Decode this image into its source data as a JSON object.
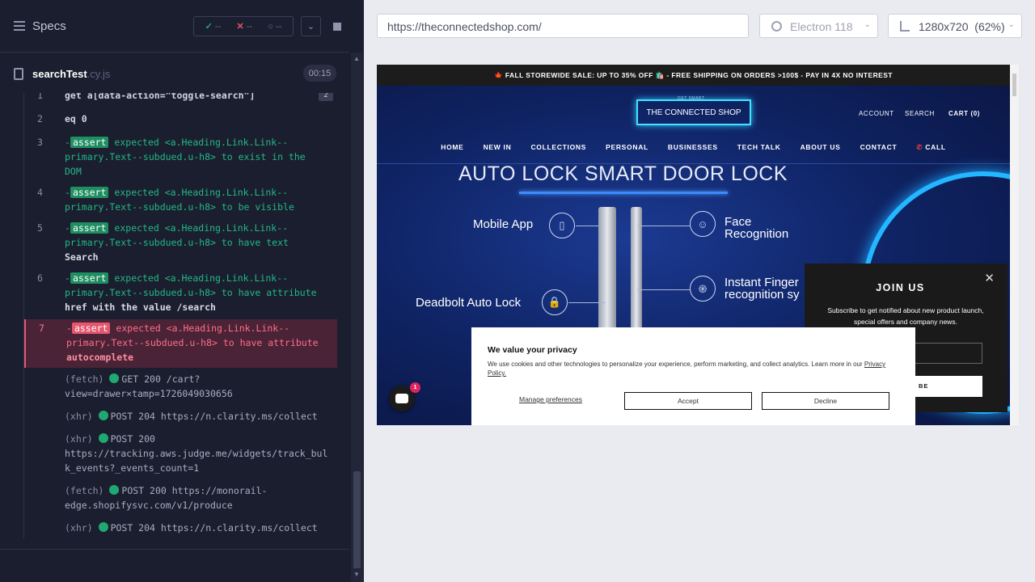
{
  "reporter": {
    "header_title": "Specs",
    "stats": {
      "passed": "--",
      "failed": "--",
      "pending": "--"
    },
    "spec_file": {
      "name": "searchTest",
      "ext": ".cy.js",
      "duration": "00:15"
    },
    "commands": [
      {
        "num": "1",
        "text": "get  a[data-action=\"toggle-search\"]",
        "count": "2"
      },
      {
        "num": "2",
        "text": "eq  0"
      },
      {
        "num": "3",
        "badge": "assert",
        "lines": [
          "expected <a.Heading.Link.Link--",
          "primary.Text--subdued.u-h8> to exist in the",
          "DOM"
        ]
      },
      {
        "num": "4",
        "badge": "assert",
        "lines": [
          "expected <a.Heading.Link.Link--",
          "primary.Text--subdued.u-h8> to be visible"
        ]
      },
      {
        "num": "5",
        "badge": "assert",
        "lines": [
          "expected <a.Heading.Link.Link--",
          "primary.Text--subdued.u-h8> to have text",
          " Search"
        ]
      },
      {
        "num": "6",
        "badge": "assert",
        "lines": [
          "expected <a.Heading.Link.Link--",
          "primary.Text--subdued.u-h8> to have attribute",
          " href with the value /search"
        ]
      },
      {
        "num": "7",
        "badge": "assert",
        "lines": [
          "expected <a.Heading.Link.Link--",
          "primary.Text--subdued.u-h8> to have attribute",
          " autocomplete"
        ]
      }
    ],
    "requests": [
      {
        "type": "(fetch)",
        "lines": [
          "GET 200 /cart?",
          "view=drawer×tamp=1726049030656"
        ]
      },
      {
        "type": "(xhr)",
        "lines": [
          "POST 204 https://n.clarity.ms/collect"
        ]
      },
      {
        "type": "(xhr)",
        "lines": [
          "POST 200",
          "https://tracking.aws.judge.me/widgets/track_bul",
          "k_events?_events_count=1"
        ]
      },
      {
        "type": "(fetch)",
        "lines": [
          "POST 200 https://monorail-",
          "edge.shopifysvc.com/v1/produce"
        ]
      },
      {
        "type": "(xhr)",
        "lines": [
          "POST 204 https://n.clarity.ms/collect"
        ]
      }
    ]
  },
  "toolbar": {
    "url": "https://theconnectedshop.com/",
    "browser": "Electron 118",
    "viewport": "1280x720",
    "zoom": "(62%)"
  },
  "site": {
    "promo": "🍁 FALL STOREWIDE SALE: UP TO 35% OFF 🛍️ - FREE SHIPPING ON ORDERS >100$ - PAY IN 4X NO INTEREST",
    "logo_tagline": "GET SMART",
    "logo": "THE CONNECTED SHOP",
    "account": "ACCOUNT",
    "search": "SEARCH",
    "cart": "CART (0)",
    "nav": [
      "HOME",
      "NEW IN",
      "COLLECTIONS",
      "PERSONAL",
      "BUSINESSES",
      "TECH TALK",
      "ABOUT US",
      "CONTACT",
      "CALL"
    ],
    "hero_title": "AUTO LOCK SMART DOOR LOCK",
    "features": {
      "mobile": "Mobile App",
      "face_1": "Face",
      "face_2": "Recognition",
      "deadbolt": "Deadbolt Auto Lock",
      "finger_1": "Instant Finger",
      "finger_2": "recognition sy"
    }
  },
  "join": {
    "title": "JOIN US",
    "text_1": "Subscribe to get notified about new product launch,",
    "text_2": "special offers and company news.",
    "button": "BE"
  },
  "privacy": {
    "title": "We value your privacy",
    "text": "We use cookies and other technologies to personalize your experience, perform marketing, and collect analytics. Learn more in our",
    "link": "Privacy Policy.",
    "manage": "Manage preferences",
    "accept": "Accept",
    "decline": "Decline"
  },
  "chat": {
    "badge": "1"
  }
}
